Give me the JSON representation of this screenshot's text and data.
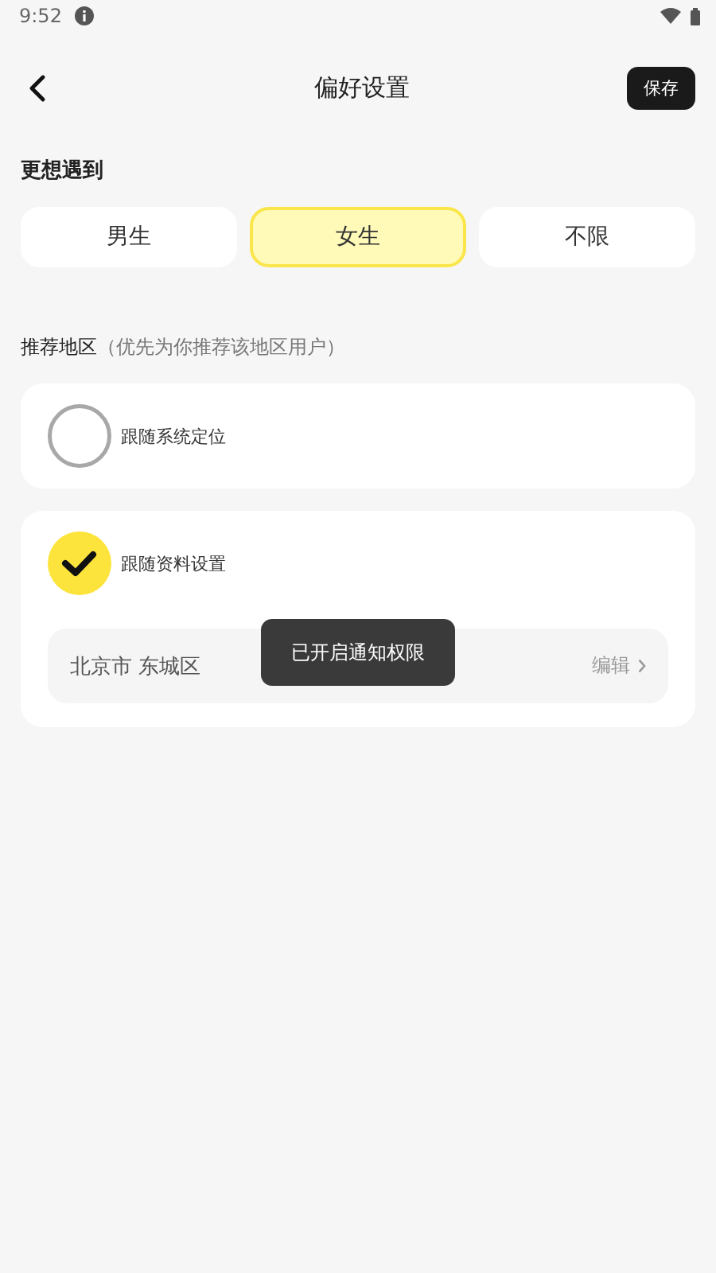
{
  "status_bar": {
    "time": "9:52"
  },
  "header": {
    "title": "偏好设置",
    "save_button": "保存"
  },
  "gender": {
    "label": "更想遇到",
    "options": [
      {
        "label": "男生",
        "selected": false
      },
      {
        "label": "女生",
        "selected": true
      },
      {
        "label": "不限",
        "selected": false
      }
    ]
  },
  "region": {
    "label": "推荐地区",
    "hint": "（优先为你推荐该地区用户）",
    "options": [
      {
        "label": "跟随系统定位",
        "selected": false
      },
      {
        "label": "跟随资料设置",
        "selected": true,
        "address": "北京市 东城区",
        "edit": "编辑"
      }
    ]
  },
  "toast": {
    "text": "已开启通知权限"
  }
}
